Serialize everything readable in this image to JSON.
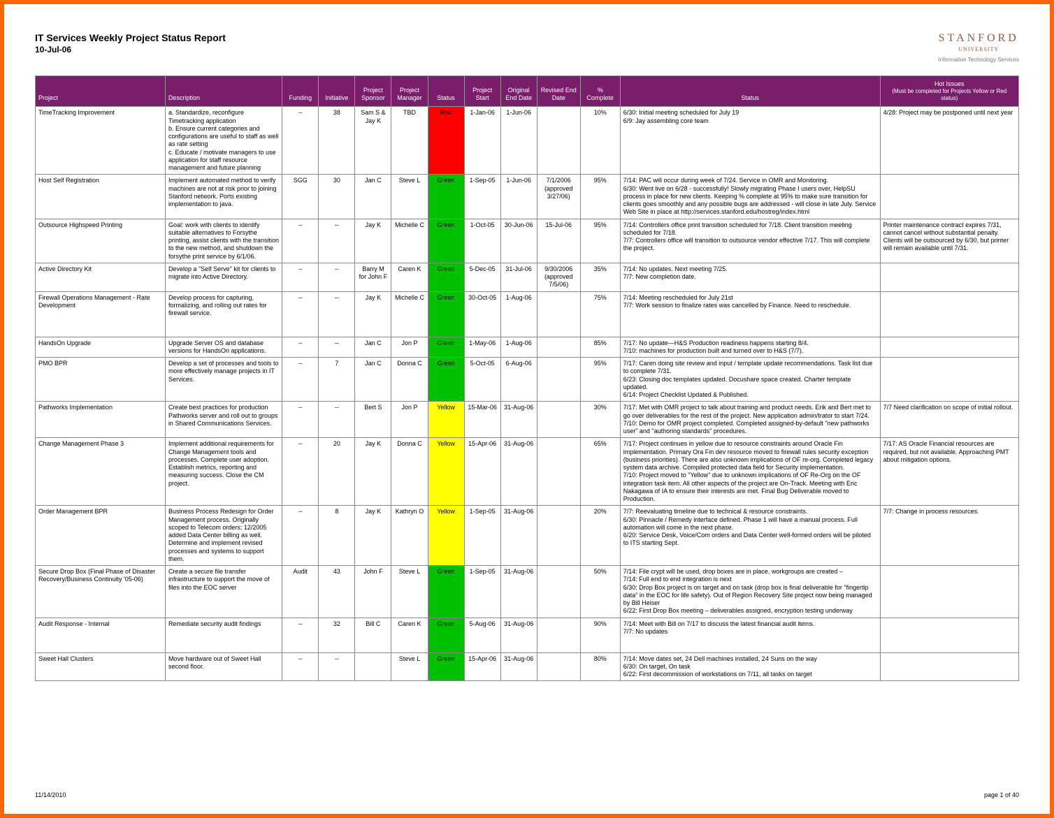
{
  "header": {
    "title": "IT Services Weekly Project Status Report",
    "date": "10-Jul-06",
    "brand_main": "STANFORD",
    "brand_sub": "UNIVERSITY",
    "brand_tag": "Information Technology Services"
  },
  "columns": {
    "project": "Project",
    "description": "Description",
    "funding": "Funding",
    "initiative": "Initiative",
    "sponsor": "Project Sponsor",
    "manager": "Project Manager",
    "status": "Status",
    "start": "Project Start",
    "orig_end": "Original End Date",
    "rev_end": "Revised End Date",
    "complete": "% Complete",
    "status_text": "Status",
    "hot_header": "Hot Issues",
    "hot_sub": "(Must be completed for Projects Yellow or Red status)"
  },
  "rows": [
    {
      "project": "TimeTracking Improvement",
      "description": "a. Standardize, reconfigure Timetracking application\nb. Ensure current categories and configurations are useful to staff as well as rate setting\nc. Educate / motivate managers to use application for staff resource management and future planning",
      "funding": "--",
      "initiative": "38",
      "sponsor": "Sam S & Jay K",
      "manager": "TBD",
      "status": "Red",
      "start": "1-Jan-06",
      "orig_end": "1-Jun-06",
      "rev_end": "",
      "complete": "10%",
      "status_text": "6/30: Initial meeting scheduled for July 19\n6/9: Jay assembling core team",
      "hot": "4/28: Project may be postponed until next year"
    },
    {
      "project": "Host Self Registration",
      "description": "Implement automated method to verify machines are not at risk prior to joining Stanford network. Ports existing implementation to java.",
      "funding": "SGG",
      "initiative": "30",
      "sponsor": "Jan C",
      "manager": "Steve L",
      "status": "Green",
      "start": "1-Sep-05",
      "orig_end": "1-Jun-06",
      "rev_end": "7/1/2006 (approved 3/27/06)",
      "complete": "95%",
      "status_text": "7/14: PAC will occur during week of 7/24. Service in OMR and Monitoring.\n6/30: Went live on 6/28 - successfully! Slowly migrating Phase I users over, HelpSU process in place for new clients. Keeping % complete at 95% to make sure transition for clients goes smoothly and any possible bugs are addressed - will close in late July. Service Web Site in place at http://services.stanford.edu/hostreg/index.html",
      "hot": ""
    },
    {
      "project": "Outsource Highspeed Printing",
      "description": "Goal: work with clients to identify suitable alternatives to Forsythe printing, assist clients with the transition to the new method, and shutdown the forsythe print service by 6/1/06.",
      "funding": "--",
      "initiative": "--",
      "sponsor": "Jay K",
      "manager": "Michelle C",
      "status": "Green",
      "start": "1-Oct-05",
      "orig_end": "30-Jun-06",
      "rev_end": "15-Jul-06",
      "complete": "95%",
      "status_text": "7/14: Controllers office print transition scheduled for 7/18. Client transition meeting scheduled for 7/18.\n7/7: Controllers office will transition to outsource vendor effective 7/17. This will complete the project.",
      "hot": "Printer maintenance contract expires 7/31, cannot cancel without substantial penalty. Clients will be outsourced by 6/30, but printer will remain available until 7/31."
    },
    {
      "project": "Active Directory Kit",
      "description": "Develop a \"Self Serve\" kit for clients to migrate into Active Directory.",
      "funding": "--",
      "initiative": "--",
      "sponsor": "Barry M for John F",
      "manager": "Caren K",
      "status": "Green",
      "start": "5-Dec-05",
      "orig_end": "31-Jul-06",
      "rev_end": "9/30/2006 (approved 7/5/06)",
      "complete": "35%",
      "status_text": "7/14: No updates. Next meeting 7/25.\n7/7: New completion date.",
      "hot": ""
    },
    {
      "project": "Firewall Operations Management - Rate Development",
      "description": "Develop process for capturing, formalizing, and rolling out rates for firewall service.",
      "funding": "--",
      "initiative": "--",
      "sponsor": "Jay K",
      "manager": "Michelle C",
      "status": "Green",
      "start": "30-Oct-05",
      "orig_end": "1-Aug-06",
      "rev_end": "",
      "complete": "75%",
      "status_text": "7/14: Meeting rescheduled for July 21st\n7/7: Work session to finalize rates was cancelled by Finance. Need to reschedule.",
      "hot": ""
    },
    {
      "project": "HandsOn Upgrade",
      "description": "Upgrade Server OS and database versions for HandsOn applications.",
      "funding": "--",
      "initiative": "--",
      "sponsor": "Jan C",
      "manager": "Jon P",
      "status": "Green",
      "start": "1-May-06",
      "orig_end": "1-Aug-06",
      "rev_end": "",
      "complete": "85%",
      "status_text": "7/17: No update—H&S Production readiness happens starting 8/4.\n7/10: machines for production built and turned over to H&S (7/7).",
      "hot": ""
    },
    {
      "project": "PMO BPR",
      "description": "Develop a set of processes and tools to more effectively manage projects in IT Services.",
      "funding": "--",
      "initiative": "7",
      "sponsor": "Jan C",
      "manager": "Donna C",
      "status": "Green",
      "start": "5-Oct-05",
      "orig_end": "6-Aug-06",
      "rev_end": "",
      "complete": "95%",
      "status_text": "7/17: Caren doing site review and input / template update recommendations. Task list due to complete 7/31.\n6/23: Closing doc templates updated. Docushare space created. Charter template updated.\n6/14: Project Checklist Updated & Published.",
      "hot": ""
    },
    {
      "project": "Pathworks Implementation",
      "description": "Create best practices for production Pathworks server and roll out to groups in Shared Communications Services.",
      "funding": "--",
      "initiative": "--",
      "sponsor": "Bert S",
      "manager": "Jon P",
      "status": "Yellow",
      "start": "15-Mar-06",
      "orig_end": "31-Aug-06",
      "rev_end": "",
      "complete": "30%",
      "status_text": "7/17: Met with OMR project to talk about training and product needs. Erik and Bert met to go over deliverables for the rest of the project. New application admin/trator to start 7/24.\n7/10: Demo for OMR project completed. Completed assigned-by-default \"new pathworks user\" and \"authoring standards\" procedures.",
      "hot": "7/7 Need clarification on scope of initial rollout."
    },
    {
      "project": "Change Management Phase 3",
      "description": "Implement additional requirements for Change Management tools and processes. Complete user adoption. Establish metrics, reporting and measuring success. Close the CM project.",
      "funding": "--",
      "initiative": "20",
      "sponsor": "Jay K",
      "manager": "Donna C",
      "status": "Yellow",
      "start": "15-Apr-06",
      "orig_end": "31-Aug-06",
      "rev_end": "",
      "complete": "65%",
      "status_text": "7/17: Project continues in yellow due to resource constraints around Oracle Fin implementation. Primary Ora Fin dev resource moved to firewall rules security exception (business priorities). There are also unknown implications of OF re-org. Completed legacy system data archive. Compiled protected data field for Security implementation.\n7/10: Project moved to \"Yellow\" due to unknown implications of OF Re-Org on the OF integration task item. All other aspects of the project are On-Track. Meeting with Eric Nakagawa of IA to ensure their interests are met. Final Bug Deliverable moved to Production.",
      "hot": "7/17: AS Oracle Financial resources are required, but not available. Approaching PMT about mitigation options."
    },
    {
      "project": "Order Management BPR",
      "description": "Business Process Redesign for Order Management process. Originally scoped to Telecom orders; 12/2005 added Data Center billing as well. Determine and implement revised processes and systems to support them.",
      "funding": "--",
      "initiative": "8",
      "sponsor": "Jay K",
      "manager": "Kathryn O",
      "status": "Yellow",
      "start": "1-Sep-05",
      "orig_end": "31-Aug-06",
      "rev_end": "",
      "complete": "20%",
      "status_text": "7/7: Reevaluating timeline due to technical & resource constraints.\n6/30: Pinnacle / Remedy interface defined. Phase 1 will have a manual process. Full automation will come in the next phase.\n6/20: Service Desk, Voice/Com orders and Data Center well-formed orders will be piloted to ITS starting Sept.",
      "hot": "7/7: Change in process resources."
    },
    {
      "project": "Secure Drop Box (Final Phase of Disaster Recovery/Business Continuity '05-06)",
      "description": "Create a secure file transfer infrastructure to support the move of files into the EOC server",
      "funding": "Audit",
      "initiative": "43",
      "sponsor": "John F",
      "manager": "Steve L",
      "status": "Green",
      "start": "1-Sep-05",
      "orig_end": "31-Aug-06",
      "rev_end": "",
      "complete": "50%",
      "status_text": "7/14: File crypt will be used, drop boxes are in place, workgroups are created –\n7/14: Full end to end integration is next\n6/30: Drop Box project is on target and on task (drop box is final deliverable for \"fingertip data\" in the EOC for life safety). Out of Region Recovery Site project now being managed by Bill Heiser\n6/22: First Drop Box meeting – deliverables assigned, encryption testing underway",
      "hot": ""
    },
    {
      "project": "Audit Response - Internal",
      "description": "Remediate security audit findings",
      "funding": "--",
      "initiative": "32",
      "sponsor": "Bill C",
      "manager": "Caren K",
      "status": "Green",
      "start": "5-Aug-06",
      "orig_end": "31-Aug-06",
      "rev_end": "",
      "complete": "90%",
      "status_text": "7/14: Meet with Bill on 7/17 to discuss the latest financial audit items.\n7/7: No updates",
      "hot": ""
    },
    {
      "project": "Sweet Hall Clusters",
      "description": "Move hardware out of Sweet Hall second floor.",
      "funding": "--",
      "initiative": "--",
      "sponsor": "",
      "manager": "Steve L",
      "status": "Green",
      "start": "15-Apr-06",
      "orig_end": "31-Aug-06",
      "rev_end": "",
      "complete": "80%",
      "status_text": "7/14: Move dates set, 24 Dell machines installed, 24 Suns on the way\n6/30: On target, On task\n6/22: First decommission of workstations on 7/11, all tasks on target",
      "hot": ""
    }
  ],
  "footer": {
    "left": "11/14/2010",
    "right": "page 1 of 40"
  }
}
